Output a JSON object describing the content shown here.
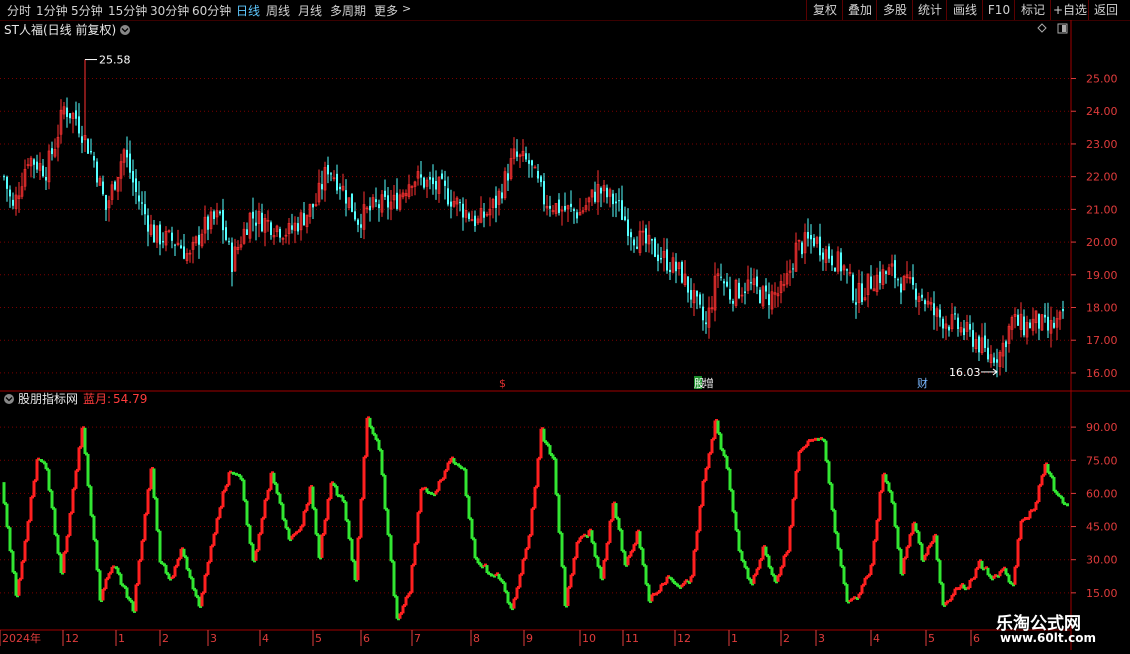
{
  "toolbar": {
    "timeframes": [
      "分时",
      "1分钟",
      "5分钟",
      "15分钟",
      "30分钟",
      "60分钟",
      "日线",
      "周线",
      "月线",
      "多周期",
      "更多"
    ],
    "active_timeframe": "日线",
    "right_buttons": [
      "复权",
      "叠加",
      "多股",
      "统计",
      "画线",
      "F10",
      "标记",
      "+自选",
      "返回"
    ]
  },
  "main_chart": {
    "title": "ST人福(日线 前复权)",
    "high_label": "25.58",
    "low_label": "16.03",
    "markers": [
      {
        "text": "$",
        "color": "#e03030"
      },
      {
        "text": "增",
        "color": "#e0e0e0"
      },
      {
        "text": "财",
        "color": "#7ab8ff"
      }
    ],
    "marker_prefix": "股"
  },
  "indicator": {
    "name": "股朋指标网",
    "label": "蓝月:",
    "value": "54.79"
  },
  "colors": {
    "up": "#ff3232",
    "down": "#54ffff",
    "ind_up": "#ff2020",
    "ind_down": "#32e632",
    "grid": "#7a0000",
    "axis_text": "#e03c3c"
  },
  "chart_data": [
    {
      "type": "candlestick",
      "title": "ST人福(日线 前复权)",
      "y_ticks": [
        16.0,
        17.0,
        18.0,
        19.0,
        20.0,
        21.0,
        22.0,
        23.0,
        24.0,
        25.0
      ],
      "ylim": [
        15.6,
        26.3
      ],
      "high": 25.58,
      "low": 16.03,
      "close_anchors": [
        [
          0,
          22.0
        ],
        [
          3,
          21.0
        ],
        [
          8,
          22.6
        ],
        [
          14,
          22.2
        ],
        [
          17,
          23.0
        ],
        [
          20,
          24.1
        ],
        [
          24,
          23.8
        ],
        [
          30,
          22.5
        ],
        [
          34,
          21.0
        ],
        [
          40,
          22.8
        ],
        [
          44,
          21.5
        ],
        [
          50,
          20.2
        ],
        [
          58,
          20.0
        ],
        [
          62,
          19.5
        ],
        [
          66,
          20.4
        ],
        [
          72,
          20.8
        ],
        [
          76,
          19.4
        ],
        [
          82,
          20.8
        ],
        [
          88,
          20.6
        ],
        [
          95,
          20.3
        ],
        [
          100,
          20.8
        ],
        [
          104,
          21.2
        ],
        [
          108,
          22.3
        ],
        [
          112,
          21.8
        ],
        [
          118,
          20.7
        ],
        [
          124,
          21.1
        ],
        [
          130,
          21.2
        ],
        [
          136,
          22.0
        ],
        [
          141,
          21.8
        ],
        [
          146,
          21.6
        ],
        [
          152,
          21.1
        ],
        [
          158,
          20.6
        ],
        [
          164,
          21.2
        ],
        [
          170,
          22.6
        ],
        [
          175,
          22.4
        ],
        [
          180,
          21.3
        ],
        [
          186,
          21.0
        ],
        [
          192,
          20.9
        ],
        [
          198,
          21.6
        ],
        [
          204,
          21.2
        ],
        [
          210,
          20.2
        ],
        [
          216,
          19.8
        ],
        [
          220,
          19.5
        ],
        [
          226,
          19.0
        ],
        [
          230,
          18.2
        ],
        [
          234,
          17.4
        ],
        [
          238,
          19.1
        ],
        [
          242,
          18.4
        ],
        [
          248,
          18.7
        ],
        [
          254,
          18.3
        ],
        [
          260,
          18.5
        ],
        [
          264,
          19.8
        ],
        [
          270,
          20.1
        ],
        [
          274,
          19.7
        ],
        [
          280,
          19.2
        ],
        [
          284,
          18.3
        ],
        [
          290,
          18.9
        ],
        [
          296,
          19.1
        ],
        [
          300,
          18.7
        ],
        [
          305,
          18.5
        ],
        [
          310,
          17.8
        ],
        [
          318,
          17.4
        ],
        [
          324,
          17.0
        ],
        [
          328,
          16.5
        ],
        [
          332,
          16.6
        ],
        [
          336,
          17.6
        ],
        [
          340,
          17.4
        ],
        [
          344,
          17.6
        ],
        [
          348,
          17.3
        ],
        [
          352,
          17.6
        ]
      ],
      "indicator": {
        "name": "股朋指标网",
        "series_name": "蓝月",
        "last_value": 54.79,
        "y_ticks": [
          15.0,
          30.0,
          45.0,
          60.0,
          75.0,
          90.0
        ],
        "ylim": [
          0,
          100
        ],
        "anchors": [
          [
            0,
            65
          ],
          [
            5,
            13
          ],
          [
            12,
            75
          ],
          [
            15,
            72
          ],
          [
            20,
            23
          ],
          [
            27,
            90
          ],
          [
            33,
            12
          ],
          [
            37,
            28
          ],
          [
            44,
            8
          ],
          [
            50,
            72
          ],
          [
            53,
            30
          ],
          [
            56,
            20
          ],
          [
            60,
            35
          ],
          [
            66,
            8
          ],
          [
            72,
            50
          ],
          [
            76,
            70
          ],
          [
            80,
            66
          ],
          [
            84,
            28
          ],
          [
            90,
            70
          ],
          [
            96,
            38
          ],
          [
            100,
            45
          ],
          [
            103,
            62
          ],
          [
            106,
            32
          ],
          [
            110,
            65
          ],
          [
            114,
            55
          ],
          [
            118,
            22
          ],
          [
            122,
            95
          ],
          [
            126,
            80
          ],
          [
            132,
            2
          ],
          [
            136,
            15
          ],
          [
            140,
            62
          ],
          [
            144,
            60
          ],
          [
            150,
            75
          ],
          [
            154,
            70
          ],
          [
            158,
            30
          ],
          [
            162,
            25
          ],
          [
            166,
            22
          ],
          [
            170,
            8
          ],
          [
            176,
            40
          ],
          [
            180,
            88
          ],
          [
            184,
            75
          ],
          [
            188,
            10
          ],
          [
            192,
            38
          ],
          [
            196,
            42
          ],
          [
            200,
            20
          ],
          [
            204,
            57
          ],
          [
            208,
            28
          ],
          [
            212,
            42
          ],
          [
            216,
            12
          ],
          [
            222,
            22
          ],
          [
            226,
            18
          ],
          [
            230,
            22
          ],
          [
            234,
            65
          ],
          [
            238,
            92
          ],
          [
            242,
            70
          ],
          [
            246,
            35
          ],
          [
            250,
            18
          ],
          [
            254,
            36
          ],
          [
            258,
            20
          ],
          [
            262,
            35
          ],
          [
            266,
            80
          ],
          [
            270,
            84
          ],
          [
            274,
            85
          ],
          [
            278,
            42
          ],
          [
            282,
            10
          ],
          [
            286,
            14
          ],
          [
            290,
            28
          ],
          [
            294,
            70
          ],
          [
            297,
            55
          ],
          [
            300,
            25
          ],
          [
            304,
            48
          ],
          [
            307,
            30
          ],
          [
            311,
            42
          ],
          [
            314,
            8
          ],
          [
            318,
            18
          ],
          [
            322,
            18
          ],
          [
            326,
            28
          ],
          [
            330,
            22
          ],
          [
            334,
            26
          ],
          [
            337,
            18
          ],
          [
            340,
            48
          ],
          [
            344,
            52
          ],
          [
            348,
            74
          ],
          [
            352,
            58
          ],
          [
            356,
            55
          ]
        ]
      },
      "x_labels": [
        "2024年",
        "12",
        "1",
        "2",
        "3",
        "4",
        "5",
        "6",
        "7",
        "8",
        "9",
        "10",
        "11",
        "12",
        "1",
        "2",
        "3",
        "4",
        "5",
        "6"
      ]
    }
  ]
}
